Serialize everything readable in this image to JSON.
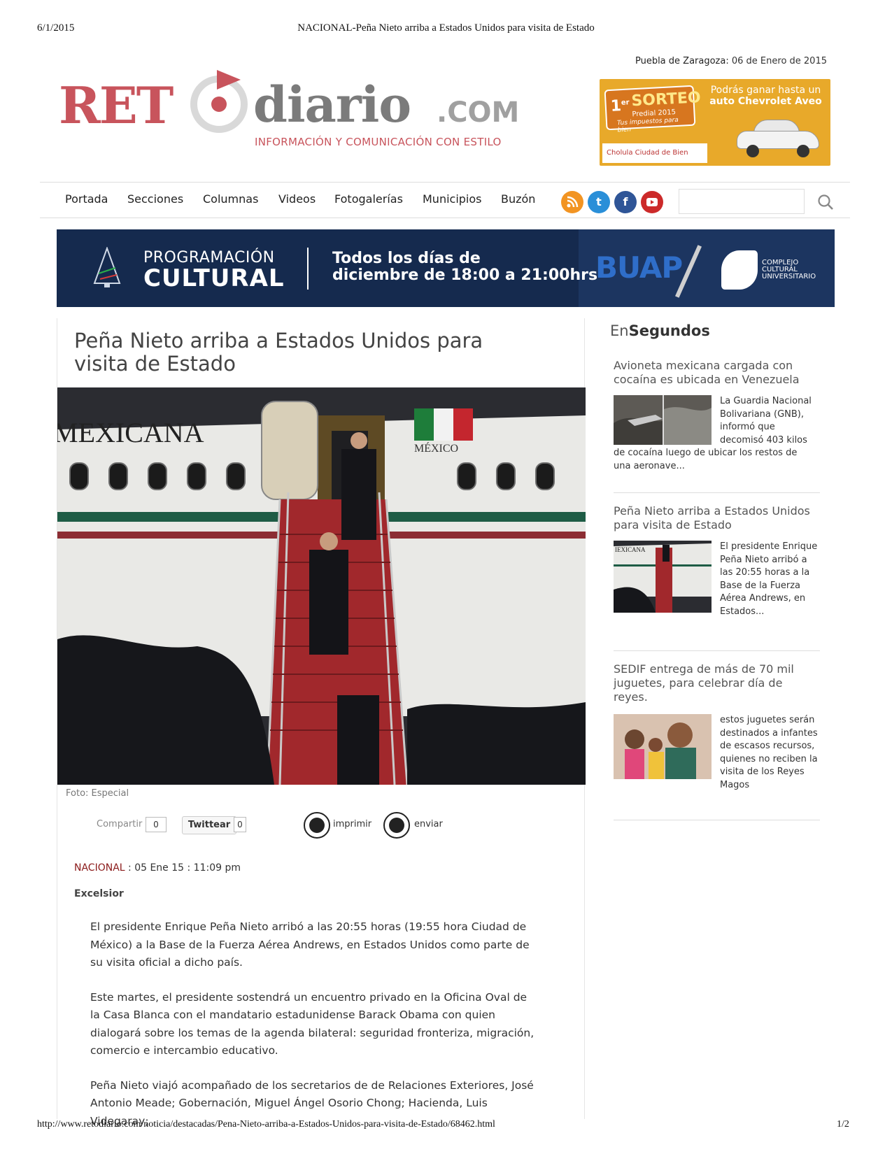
{
  "print": {
    "date": "6/1/2015",
    "title": "NACIONAL-Peña Nieto arriba a Estados Unidos para visita de Estado",
    "url": "http://www.retodiario.com/noticia/destacadas/Pena-Nieto-arriba-a-Estados-Unidos-para-visita-de-Estado/68462.html",
    "page": "1/2"
  },
  "header": {
    "dateline_place": "Puebla de Zaragoza:",
    "dateline_date": "06 de Enero de 2015",
    "logo": {
      "ret": "RET",
      "diario": "diario",
      "com": ".COM",
      "tagline": "INFORMACIÓN Y COMUNICACIÓN CON ESTILO"
    }
  },
  "promo": {
    "sup": "1",
    "sup_er": "er",
    "sorteo": "SORTEO",
    "predial": "Predial 2015",
    "lema": "Tus impuestos para bien",
    "claim_line1": "Podrás ganar hasta un",
    "claim_line2": "auto Chevrolet Aveo",
    "logos": "Cholula   Ciudad de Bien"
  },
  "nav": {
    "items": [
      "Portada",
      "Secciones",
      "Columnas",
      "Videos",
      "Fotogalerías",
      "Municipios",
      "Buzón"
    ],
    "social": [
      "rss-icon",
      "twitter-icon",
      "facebook-icon",
      "youtube-icon"
    ],
    "search_placeholder": ""
  },
  "banner": {
    "prog_line1": "PROGRAMACIÓN",
    "prog_line2": "CULTURAL",
    "todos_line1": "Todos los días de",
    "todos_line2": "diciembre de 18:00 a 21:00hrs",
    "buap": "BUAP",
    "ccu_line1": "COMPLEJO",
    "ccu_line2": "CULTURAL",
    "ccu_line3": "UNIVERSITARIO"
  },
  "article": {
    "headline": "Peña Nieto arriba a Estados Unidos para visita de Estado",
    "photo_text_airline": "MEXICANA",
    "photo_text_country": "MÉXICO",
    "caption": "Foto: Especial",
    "share": {
      "compartir": "Compartir",
      "compartir_count": "0",
      "twittear": "Twittear",
      "twittear_count": "0",
      "imprimir": "imprimir",
      "enviar": "enviar"
    },
    "section": "NACIONAL",
    "datetime": " : 05 Ene 15 : 11:09 pm",
    "source": "Excelsior",
    "paragraphs": [
      "El presidente Enrique Peña Nieto arribó a las 20:55 horas (19:55 hora Ciudad de México) a la Base de la Fuerza Aérea Andrews, en Estados Unidos como parte de su visita oficial a dicho país.",
      "Este martes, el presidente sostendrá un encuentro privado en la Oficina Oval de la Casa Blanca con el mandatario estadunidense Barack Obama con quien dialogará sobre los temas de la agenda bilateral: seguridad fronteriza, migración, comercio e intercambio educativo.",
      "Peña Nieto viajó acompañado de los secretarios de de Relaciones Exteriores, José Antonio Meade; Gobernación, Miguel Ángel Osorio Chong; Hacienda, Luis Videgaray;"
    ]
  },
  "sidebar": {
    "title_en": "En",
    "title_segundos": "Segundos",
    "news": [
      {
        "title": "Avioneta mexicana cargada con cocaína es ubicada en Venezuela",
        "snippet": "La Guardia Nacional Bolivariana (GNB), informó que decomisó 403 kilos de cocaína luego de ubicar los restos de una aeronave..."
      },
      {
        "title": "Peña Nieto arriba a Estados Unidos para visita de Estado",
        "snippet": "El presidente Enrique Peña Nieto arribó a las 20:55 horas a la Base de la Fuerza Aérea Andrews, en Estados...",
        "thumb_text": "IEXICANA"
      },
      {
        "title": "SEDIF entrega de más de 70 mil juguetes, para celebrar día de reyes.",
        "snippet": "estos juguetes serán destinados a infantes de escasos recursos, quienes no reciben la visita de los Reyes Magos"
      }
    ]
  },
  "colors": {
    "brand_red": "#c8545c",
    "section_red": "#8b1a1a",
    "banner_navy": "#152a4e",
    "promo_orange": "#e8a92a"
  }
}
